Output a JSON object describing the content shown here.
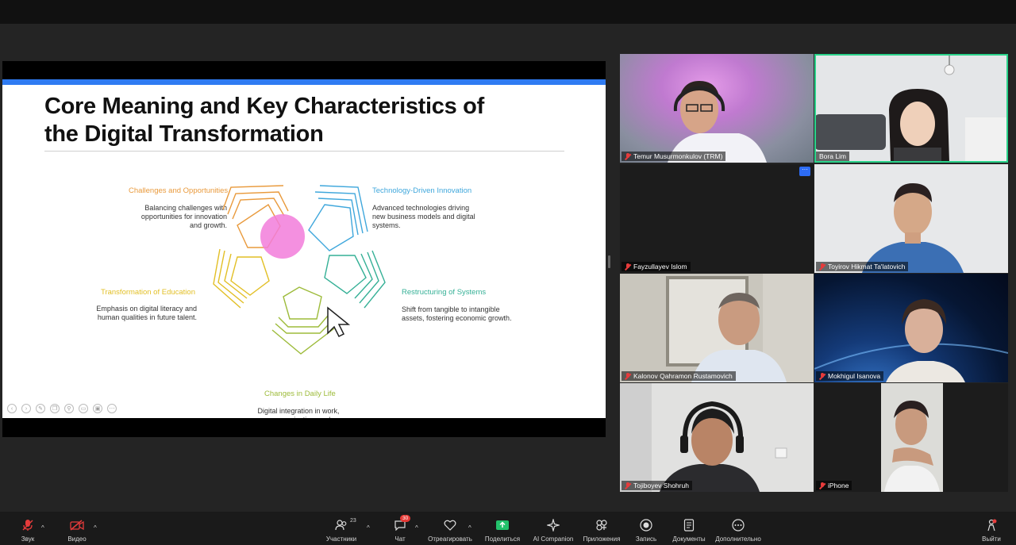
{
  "slide": {
    "title_line1": "Core Meaning and Key Characteristics of",
    "title_line2": "the Digital Transformation",
    "items": [
      {
        "title": "Challenges and Opportunities",
        "desc": "Balancing challenges with opportunities for innovation and growth.",
        "color": "#e99a3c"
      },
      {
        "title": "Technology-Driven Innovation",
        "desc": "Advanced technologies driving new business models and digital systems.",
        "color": "#3fa7dc"
      },
      {
        "title": "Transformation of Education",
        "desc": "Emphasis on digital literacy and human qualities in future talent.",
        "color": "#e2bf25"
      },
      {
        "title": "Restructuring of Systems",
        "desc": "Shift from tangible to intangible assets, fostering economic growth.",
        "color": "#35b096"
      },
      {
        "title": "Changes in Daily Life",
        "desc": "Digital integration in work, communication, and consumption patterns.",
        "color": "#9dbb3a"
      }
    ],
    "highlight_color": "#f27ddb"
  },
  "participants": [
    {
      "name": "Temur Musurmonkulov (TRM)",
      "muted": true
    },
    {
      "name": "Bora Lim",
      "muted": false
    },
    {
      "name": "Fayzullayev Islom",
      "muted": true
    },
    {
      "name": "Toyirov Hikmat Ta'latovich",
      "muted": true
    },
    {
      "name": "Kalonov Qahramon Rustamovich",
      "muted": true
    },
    {
      "name": "Mokhigul Isanova",
      "muted": true
    },
    {
      "name": "Tojiboyev Shohruh",
      "muted": true
    },
    {
      "name": "iPhone",
      "muted": true
    }
  ],
  "more_label": "···",
  "toolbar": {
    "audio": "Звук",
    "video": "Видео",
    "participants": "Участники",
    "participants_count": "23",
    "chat": "Чат",
    "chat_badge": "30",
    "react": "Отреагировать",
    "share": "Поделиться",
    "ai": "AI Companion",
    "apps": "Приложения",
    "record": "Запись",
    "docs": "Документы",
    "more": "Дополнительно",
    "leave": "Выйти"
  },
  "colors": {
    "accent": "#2f7bf2",
    "active_border": "#2ad38b",
    "share_green": "#23c26b",
    "muted_red": "#e63b3b"
  }
}
